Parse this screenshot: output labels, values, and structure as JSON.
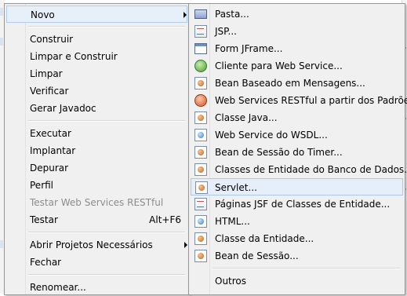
{
  "menu": {
    "items": [
      {
        "label": "Novo",
        "submenu": true,
        "highlighted": true
      },
      {
        "label": "Construir"
      },
      {
        "label": "Limpar e Construir"
      },
      {
        "label": "Limpar"
      },
      {
        "label": "Verificar"
      },
      {
        "label": "Gerar Javadoc"
      },
      {
        "label": "Executar"
      },
      {
        "label": "Implantar"
      },
      {
        "label": "Depurar"
      },
      {
        "label": "Perfil"
      },
      {
        "label": "Testar Web Services RESTful",
        "disabled": true
      },
      {
        "label": "Testar",
        "shortcut": "Alt+F6"
      },
      {
        "label": "Abrir Projetos Necessários",
        "submenu": true
      },
      {
        "label": "Fechar"
      },
      {
        "label": "Renomear..."
      }
    ]
  },
  "submenu": {
    "items": [
      {
        "label": "Pasta...",
        "icon": "folder-icon"
      },
      {
        "label": "JSP...",
        "icon": "jsp-file-icon"
      },
      {
        "label": "Form JFrame...",
        "icon": "jframe-form-icon"
      },
      {
        "label": "Cliente para Web Service...",
        "icon": "web-service-client-icon"
      },
      {
        "label": "Bean Baseado em Mensagens...",
        "icon": "message-bean-icon"
      },
      {
        "label": "Web Services RESTful a partir dos Padrões...",
        "icon": "restful-service-icon"
      },
      {
        "label": "Classe Java...",
        "icon": "java-class-icon"
      },
      {
        "label": "Web Service do WSDL...",
        "icon": "wsdl-service-icon"
      },
      {
        "label": "Bean de Sessão do Timer...",
        "icon": "timer-session-bean-icon"
      },
      {
        "label": "Classes de Entidade do Banco de Dados...",
        "icon": "entity-classes-icon"
      },
      {
        "label": "Servlet...",
        "icon": "servlet-icon",
        "highlighted": true
      },
      {
        "label": "Páginas JSF de Classes de Entidade...",
        "icon": "jsf-pages-icon"
      },
      {
        "label": "HTML...",
        "icon": "html-file-icon"
      },
      {
        "label": "Classe da Entidade...",
        "icon": "entity-class-icon"
      },
      {
        "label": "Bean de Sessão...",
        "icon": "session-bean-icon"
      },
      {
        "label": "Outros"
      }
    ]
  }
}
